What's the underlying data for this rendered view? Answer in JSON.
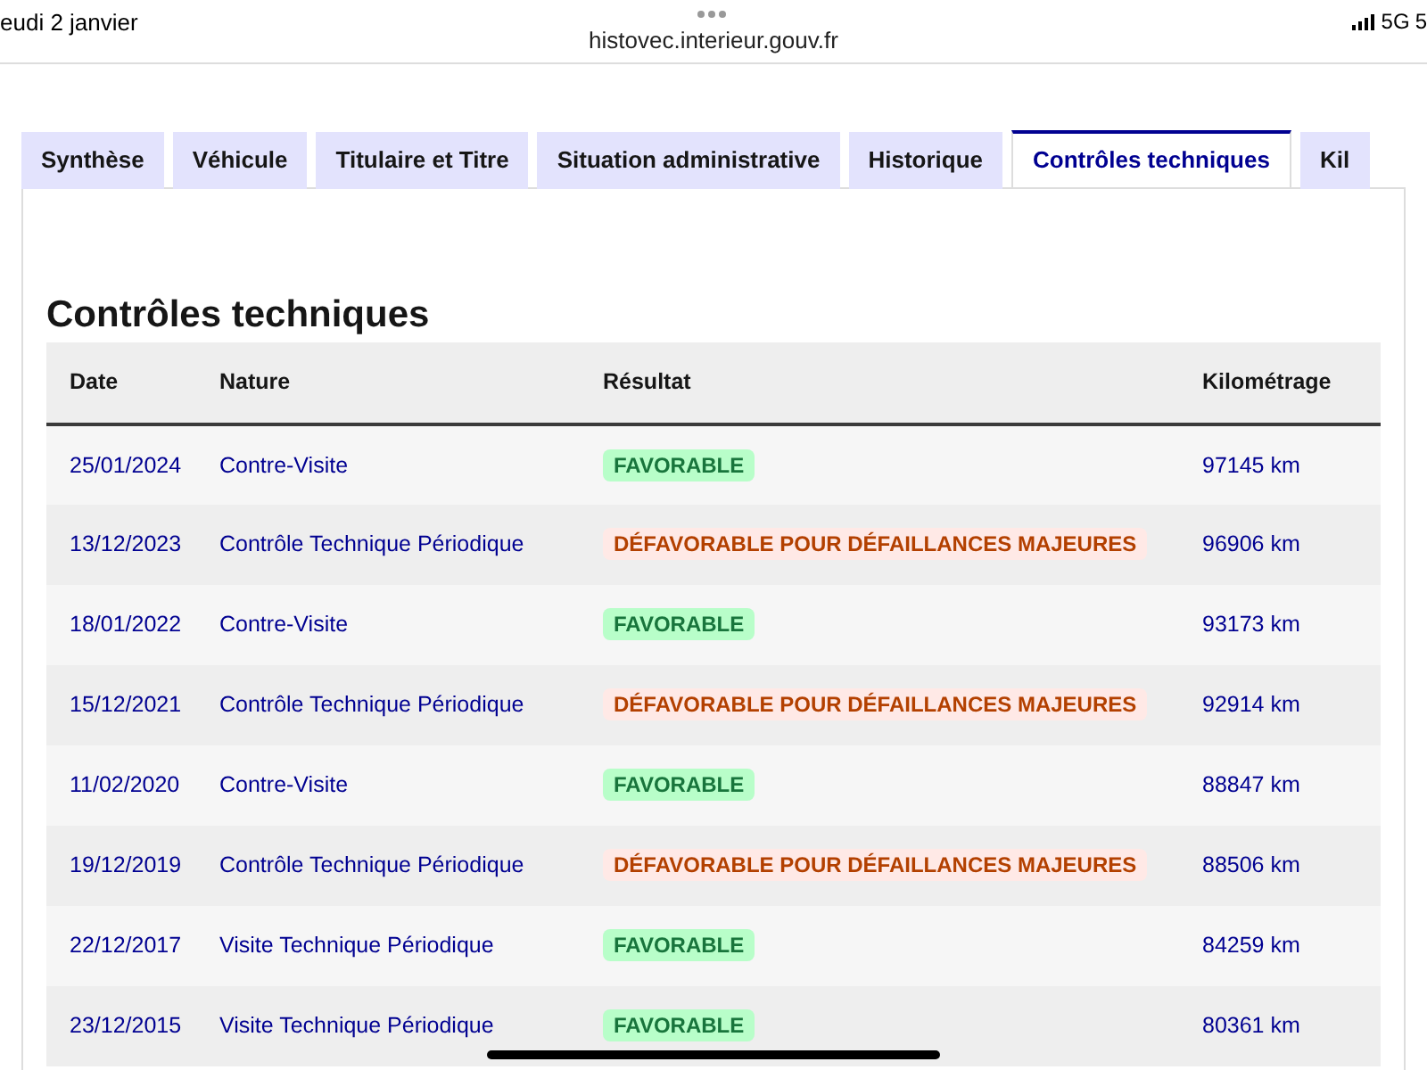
{
  "status_bar": {
    "date": "eudi 2 janvier",
    "network": "5G",
    "battery": "5"
  },
  "address_bar": {
    "url": "histovec.interieur.gouv.fr"
  },
  "tabs": [
    {
      "label": "Synthèse",
      "selected": false
    },
    {
      "label": "Véhicule",
      "selected": false
    },
    {
      "label": "Titulaire et Titre",
      "selected": false
    },
    {
      "label": "Situation administrative",
      "selected": false
    },
    {
      "label": "Historique",
      "selected": false
    },
    {
      "label": "Contrôles techniques",
      "selected": true
    },
    {
      "label": "Kil",
      "selected": false
    }
  ],
  "section_title": "Contrôles techniques",
  "table": {
    "columns": [
      "Date",
      "Nature",
      "Résultat",
      "Kilométrage"
    ],
    "rows": [
      {
        "date": "25/01/2024",
        "nature": "Contre-Visite",
        "result": {
          "kind": "favorable",
          "label": "FAVORABLE"
        },
        "mileage": "97145 km"
      },
      {
        "date": "13/12/2023",
        "nature": "Contrôle Technique Périodique",
        "result": {
          "kind": "unfavorable",
          "label": "DÉFAVORABLE POUR DÉFAILLANCES MAJEURES"
        },
        "mileage": "96906 km"
      },
      {
        "date": "18/01/2022",
        "nature": "Contre-Visite",
        "result": {
          "kind": "favorable",
          "label": "FAVORABLE"
        },
        "mileage": "93173 km"
      },
      {
        "date": "15/12/2021",
        "nature": "Contrôle Technique Périodique",
        "result": {
          "kind": "unfavorable",
          "label": "DÉFAVORABLE POUR DÉFAILLANCES MAJEURES"
        },
        "mileage": "92914 km"
      },
      {
        "date": "11/02/2020",
        "nature": "Contre-Visite",
        "result": {
          "kind": "favorable",
          "label": "FAVORABLE"
        },
        "mileage": "88847 km"
      },
      {
        "date": "19/12/2019",
        "nature": "Contrôle Technique Périodique",
        "result": {
          "kind": "unfavorable",
          "label": "DÉFAVORABLE POUR DÉFAILLANCES MAJEURES"
        },
        "mileage": "88506 km"
      },
      {
        "date": "22/12/2017",
        "nature": "Visite Technique Périodique",
        "result": {
          "kind": "favorable",
          "label": "FAVORABLE"
        },
        "mileage": "84259 km"
      },
      {
        "date": "23/12/2015",
        "nature": "Visite Technique Périodique",
        "result": {
          "kind": "favorable",
          "label": "FAVORABLE"
        },
        "mileage": "80361 km"
      }
    ]
  }
}
